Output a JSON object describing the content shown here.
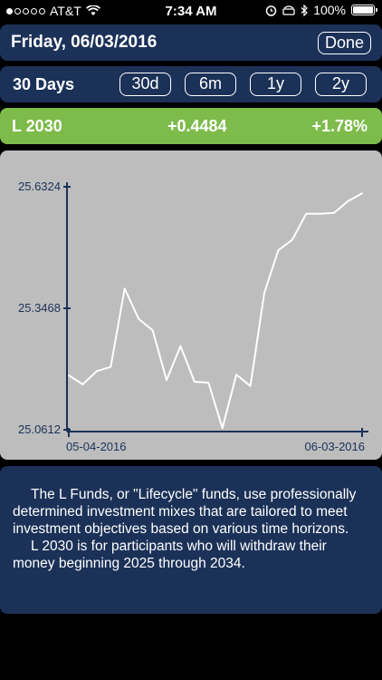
{
  "status_bar": {
    "carrier": "AT&T",
    "time": "7:34 AM",
    "battery": "100%",
    "signal_dots_filled": 1,
    "signal_dots_total": 5
  },
  "header": {
    "title": "Friday, 06/03/2016",
    "done_label": "Done"
  },
  "range": {
    "label": "30 Days",
    "buttons": [
      "30d",
      "6m",
      "1y",
      "2y"
    ]
  },
  "fund": {
    "name": "L 2030",
    "change": "+0.4484",
    "percent": "+1.78%",
    "color": "#7dbb4b"
  },
  "chart_data": {
    "type": "line",
    "y_ticks": [
      "25.6324",
      "25.3468",
      "25.0612"
    ],
    "x_ticks": [
      "05-04-2016",
      "06-03-2016"
    ],
    "ylim": [
      25.0612,
      25.6324
    ],
    "line_color": "#ffffff",
    "series": [
      {
        "values": [
          25.189,
          25.168,
          25.199,
          25.209,
          25.393,
          25.322,
          25.295,
          25.178,
          25.258,
          25.174,
          25.172,
          25.065,
          25.191,
          25.164,
          25.383,
          25.483,
          25.508,
          25.569,
          25.569,
          25.571,
          25.599,
          25.617
        ]
      }
    ]
  },
  "description": {
    "para1": "The L Funds, or \"Lifecycle\" funds, use professionally determined investment mixes that are tailored to meet investment objectives based on various time horizons.",
    "para2": "L 2030 is for participants who will withdraw their money beginning 2025 through 2034."
  }
}
